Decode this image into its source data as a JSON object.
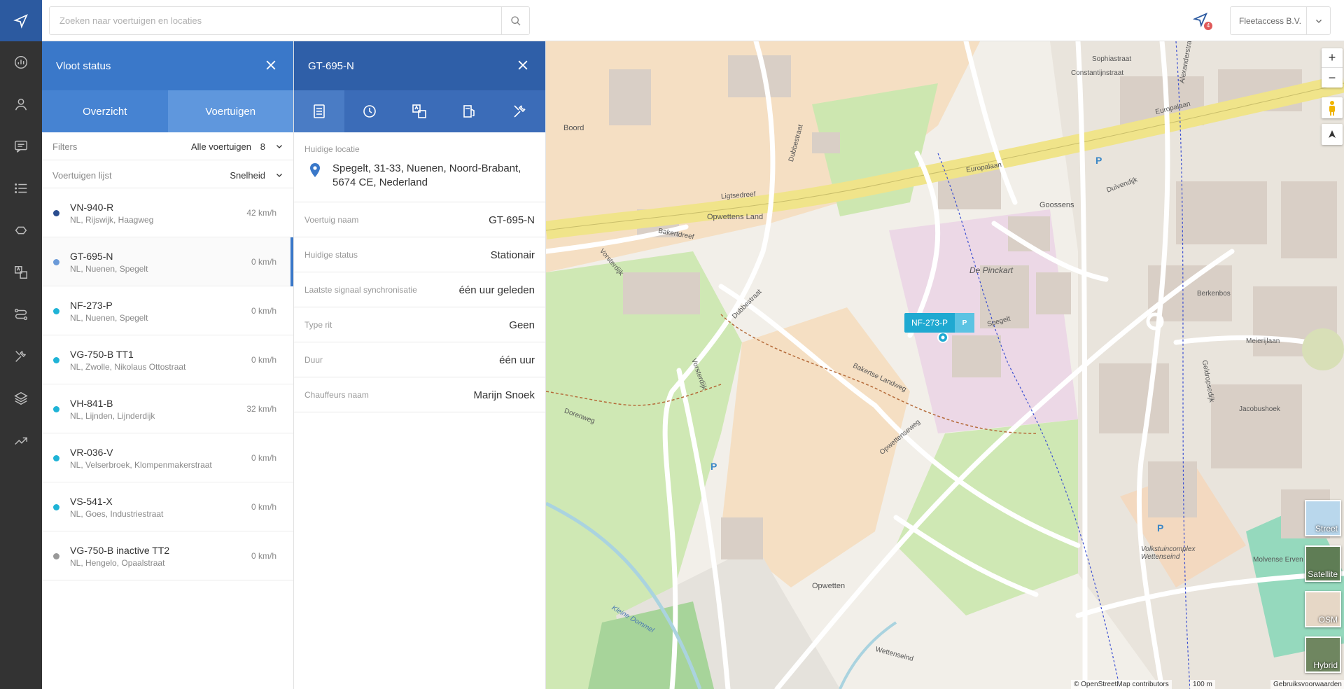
{
  "search": {
    "placeholder": "Zoeken naar voertuigen en locaties"
  },
  "header": {
    "notification_count": "4",
    "account": "Fleetaccess B.V."
  },
  "fleet_panel": {
    "title": "Vloot status",
    "tabs": [
      "Overzicht",
      "Voertuigen"
    ],
    "filters_label": "Filters",
    "filters_value": "Alle voertuigen",
    "filters_count": "8",
    "list_label": "Voertuigen lijst",
    "list_sort": "Snelheid",
    "vehicles": [
      {
        "plate": "VN-940-R",
        "location": "NL, Rijswijk, Haagweg",
        "speed": "42 km/h",
        "color": "#2a4d8f"
      },
      {
        "plate": "GT-695-N",
        "location": "NL, Nuenen, Spegelt",
        "speed": "0 km/h",
        "color": "#6b9ad8"
      },
      {
        "plate": "NF-273-P",
        "location": "NL, Nuenen, Spegelt",
        "speed": "0 km/h",
        "color": "#1fb3d6"
      },
      {
        "plate": "VG-750-B TT1",
        "location": "NL, Zwolle, Nikolaus Ottostraat",
        "speed": "0 km/h",
        "color": "#1fb3d6"
      },
      {
        "plate": "VH-841-B",
        "location": "NL, Lijnden, Lijnderdijk",
        "speed": "32 km/h",
        "color": "#1fb3d6"
      },
      {
        "plate": "VR-036-V",
        "location": "NL, Velserbroek, Klompenmakerstraat",
        "speed": "0 km/h",
        "color": "#1fb3d6"
      },
      {
        "plate": "VS-541-X",
        "location": "NL, Goes, Industriestraat",
        "speed": "0 km/h",
        "color": "#1fb3d6"
      },
      {
        "plate": "VG-750-B inactive TT2",
        "location": "NL, Hengelo, Opaalstraat",
        "speed": "0 km/h",
        "color": "#999999"
      }
    ]
  },
  "detail_panel": {
    "title": "GT-695-N",
    "location_label": "Huidige locatie",
    "address_line1": "Spegelt, 31-33, Nuenen, Noord-Brabant,",
    "address_line2": "5674 CE, Nederland",
    "rows": [
      {
        "label": "Voertuig naam",
        "value": "GT-695-N"
      },
      {
        "label": "Huidige status",
        "value": "Stationair"
      },
      {
        "label": "Laatste signaal synchronisatie",
        "value": "één uur geleden"
      },
      {
        "label": "Type rit",
        "value": "Geen"
      },
      {
        "label": "Duur",
        "value": "één uur"
      },
      {
        "label": "Chauffeurs naam",
        "value": "Marijn Snoek"
      }
    ]
  },
  "map": {
    "marker_plate": "NF-273-P",
    "marker_badge": "P",
    "zoom_in": "+",
    "zoom_out": "−",
    "layers": [
      "Street",
      "Satellite",
      "OSM",
      "Hybrid"
    ],
    "attribution": "© OpenStreetMap contributors",
    "scale": "100 m",
    "terms": "Gebruiksvoorwaarden",
    "labels": {
      "europalaan": "Europalaan",
      "ligtsedreef": "Ligtsedreef",
      "opwettens_land": "Opwettens Land",
      "bakertdreef": "Bakertdreef",
      "dubbestraat": "Dubbestraat",
      "vorsterdijk": "Vorsterdijk",
      "boord": "Boord",
      "de_pinckart": "De Pinckart",
      "goossens": "Goossens",
      "opwetten": "Opwetten",
      "opwettenseweg": "Opwettenseweg",
      "bakertse_landweg": "Bakertse Landweg",
      "spegelt": "Spegelt",
      "meierijlaan": "Meierijlaan",
      "wettenseind": "Wettenseind",
      "jacobushoek": "Jacobushoek",
      "volkstuincomplex": "Volkstuincomplex Wettenseind",
      "molvense_erven": "Molvense Erven",
      "dorenweg": "Dorenweg",
      "kleine_dommel": "Kleine Dommel",
      "berkenbos": "Berkenbos",
      "duivendijk": "Duivendijk",
      "geldropsedijk": "Geldropsedijk",
      "sophiastraat": "Sophiastraat",
      "constantijnstraat": "Constantijnstraat",
      "alexanderstraat": "Alexanderstraat"
    }
  }
}
